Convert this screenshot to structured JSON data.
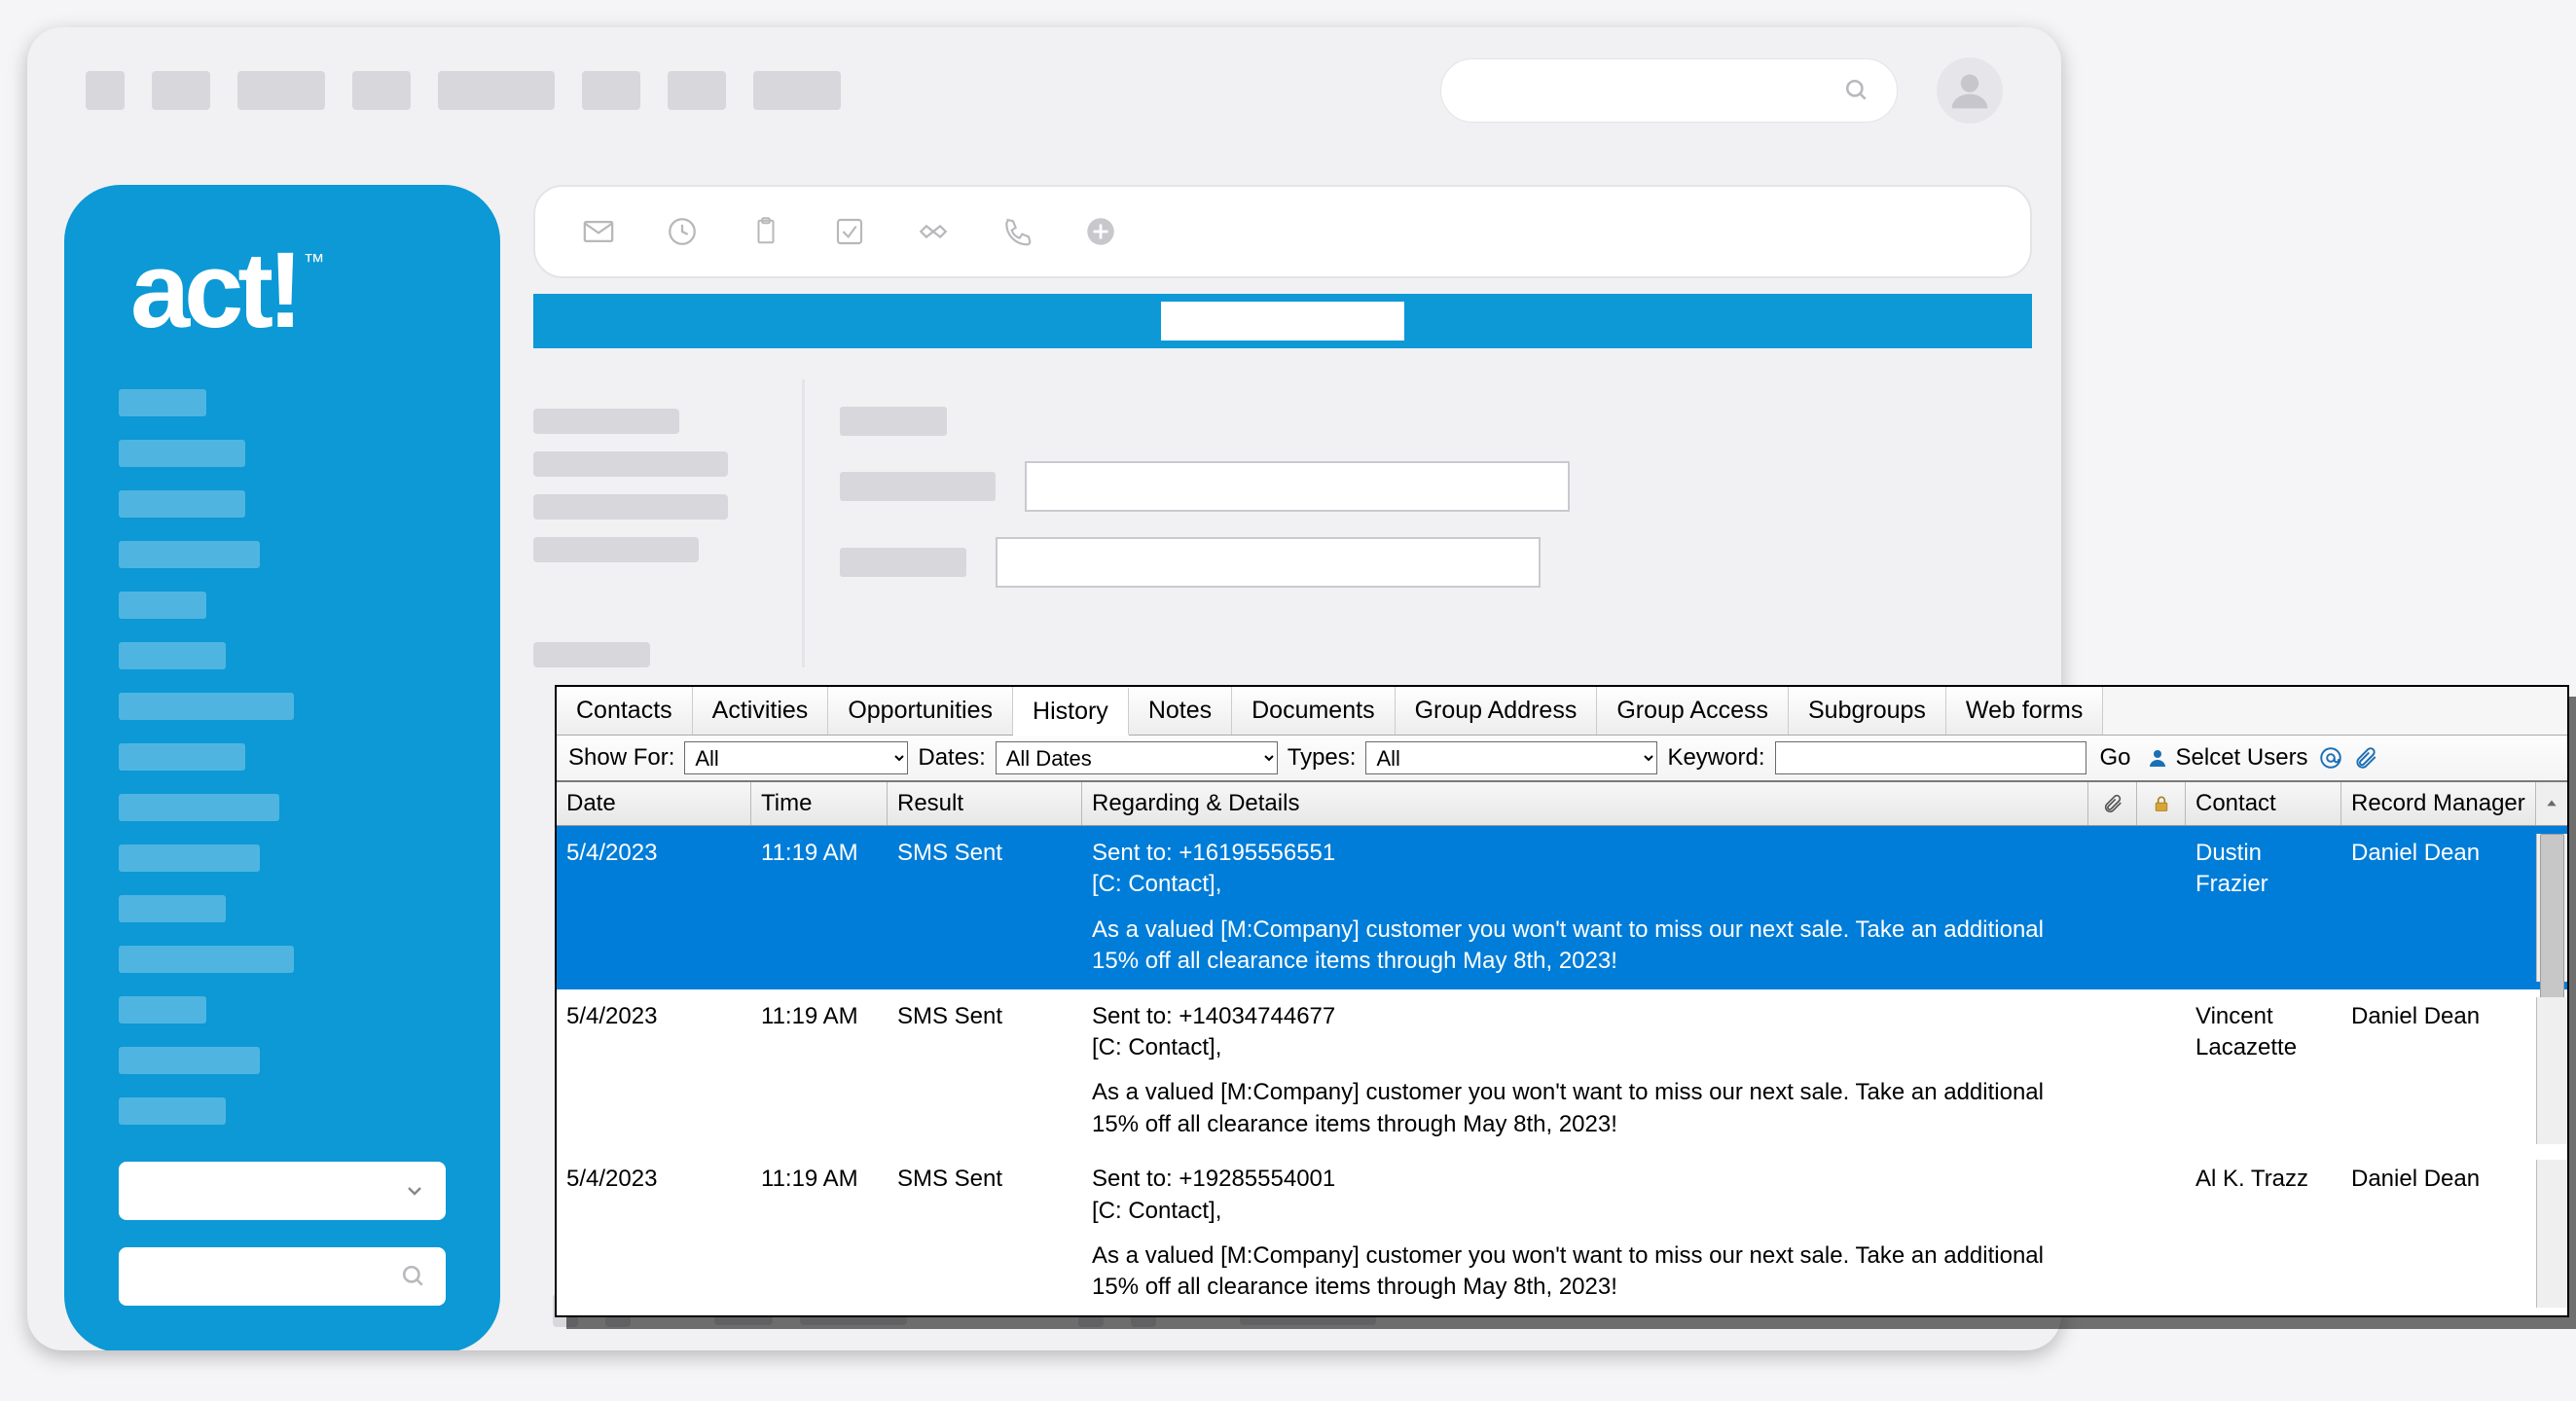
{
  "app": {
    "logo_text": "act!",
    "logo_tm": "™"
  },
  "toolbar_icons": [
    "mail-icon",
    "clock-icon",
    "clipboard-icon",
    "checkbox-icon",
    "handshake-icon",
    "phone-icon",
    "plus-icon"
  ],
  "tabs": [
    {
      "label": "Contacts"
    },
    {
      "label": "Activities"
    },
    {
      "label": "Opportunities"
    },
    {
      "label": "History",
      "active": true
    },
    {
      "label": "Notes"
    },
    {
      "label": "Documents"
    },
    {
      "label": "Group Address"
    },
    {
      "label": "Group Access"
    },
    {
      "label": "Subgroups"
    },
    {
      "label": "Web forms"
    }
  ],
  "filters": {
    "show_for_label": "Show For:",
    "show_for_value": "All",
    "dates_label": "Dates:",
    "dates_value": "All Dates",
    "types_label": "Types:",
    "types_value": "All",
    "keyword_label": "Keyword:",
    "keyword_value": "",
    "go_label": "Go",
    "select_users_label": "Selcet Users"
  },
  "columns": {
    "date": "Date",
    "time": "Time",
    "result": "Result",
    "regarding": "Regarding & Details",
    "contact": "Contact",
    "record_manager": "Record Manager"
  },
  "rows": [
    {
      "date": "5/4/2023",
      "time": "11:19 AM",
      "result": "SMS Sent",
      "sent_to": "Sent to: +16195556551",
      "c_line": "[C: Contact],",
      "body": "As a valued [M:Company] customer you won't want to miss our next sale. Take an additional 15% off all clearance items through May 8th, 2023!",
      "contact": "Dustin Frazier",
      "record_manager": "Daniel Dean",
      "selected": true
    },
    {
      "date": "5/4/2023",
      "time": "11:19 AM",
      "result": "SMS Sent",
      "sent_to": "Sent to: +14034744677",
      "c_line": "[C: Contact],",
      "body": "As a valued [M:Company] customer you won't want to miss our next sale. Take an additional 15% off all clearance items through May 8th, 2023!",
      "contact": "Vincent Lacazette",
      "record_manager": "Daniel Dean",
      "selected": false
    },
    {
      "date": "5/4/2023",
      "time": "11:19 AM",
      "result": "SMS Sent",
      "sent_to": "Sent to: +19285554001",
      "c_line": "[C: Contact],",
      "body": "As a valued [M:Company] customer you won't want to miss our next sale. Take an additional 15% off all clearance items through May 8th, 2023!",
      "contact": "Al K. Trazz",
      "record_manager": "Daniel Dean",
      "selected": false
    }
  ]
}
